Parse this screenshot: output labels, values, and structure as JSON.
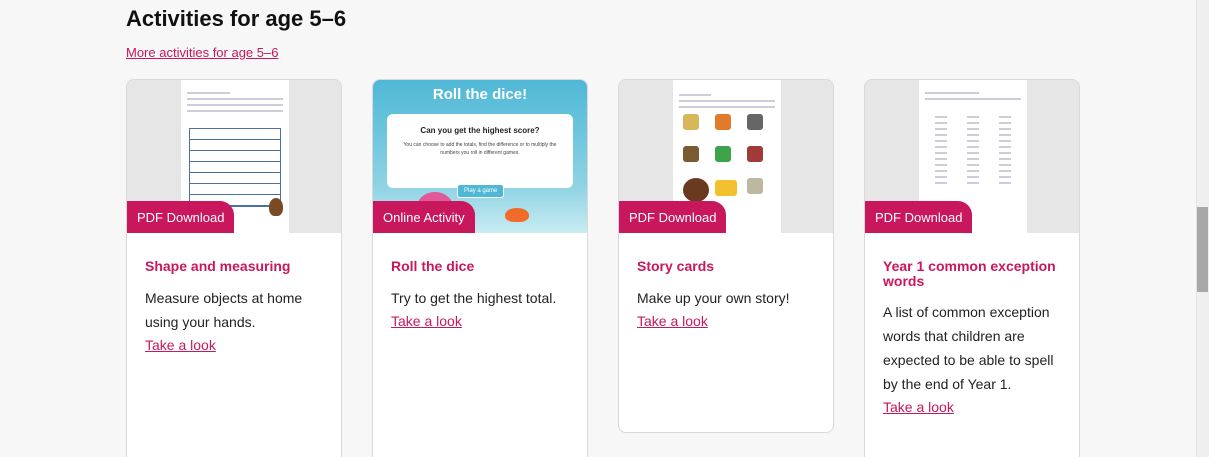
{
  "section": {
    "title": "Activities for age 5–6",
    "more_link": "More activities for age 5–6"
  },
  "cards": [
    {
      "badge": "PDF Download",
      "title": "Shape and measuring",
      "desc": "Measure objects at home using your hands.",
      "link": "Take a look"
    },
    {
      "badge": "Online Activity",
      "title": "Roll the dice",
      "desc": "Try to get the highest total.",
      "link": "Take a look",
      "thumb": {
        "heading": "Roll the dice!",
        "question": "Can you get the highest score?",
        "text": "You can choose to add the totals, find the difference or to multiply the numbers you roll in different games.",
        "button": "Play a game"
      }
    },
    {
      "badge": "PDF Download",
      "title": "Story cards",
      "desc": "Make up your own story!",
      "link": "Take a look"
    },
    {
      "badge": "PDF Download",
      "title": "Year 1 common exception words",
      "desc": "A list of common exception words that children are expected to be able to spell by the end of Year 1.",
      "link": "Take a look"
    }
  ],
  "colors": {
    "accent": "#c8175d",
    "scrollbar": "#a8a8a8"
  }
}
